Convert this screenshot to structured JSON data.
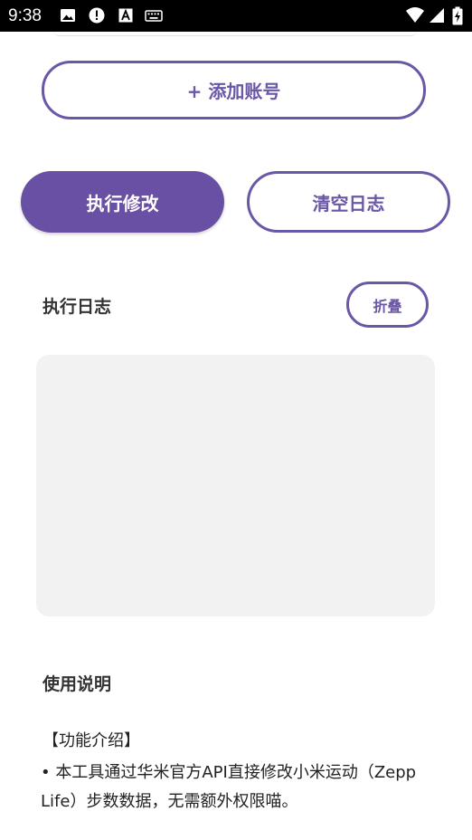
{
  "status_bar": {
    "time": "9:38",
    "left_icons": [
      "image-icon",
      "alert-icon",
      "a-icon",
      "keyboard-icon"
    ],
    "right_icons": [
      "wifi-icon",
      "signal-icon",
      "battery-charging-icon"
    ]
  },
  "accent_color": "#6a50a4",
  "add_account": {
    "label": "+ 添加账号"
  },
  "actions": {
    "execute_label": "执行修改",
    "clear_label": "清空日志"
  },
  "log": {
    "title": "执行日志",
    "collapse_label": "折叠",
    "content": ""
  },
  "usage": {
    "title": "使用说明",
    "section": "【功能介绍】",
    "text": "• 本工具通过华米官方API直接修改小米运动（Zepp Life）步数数据，无需额外权限喵。"
  }
}
